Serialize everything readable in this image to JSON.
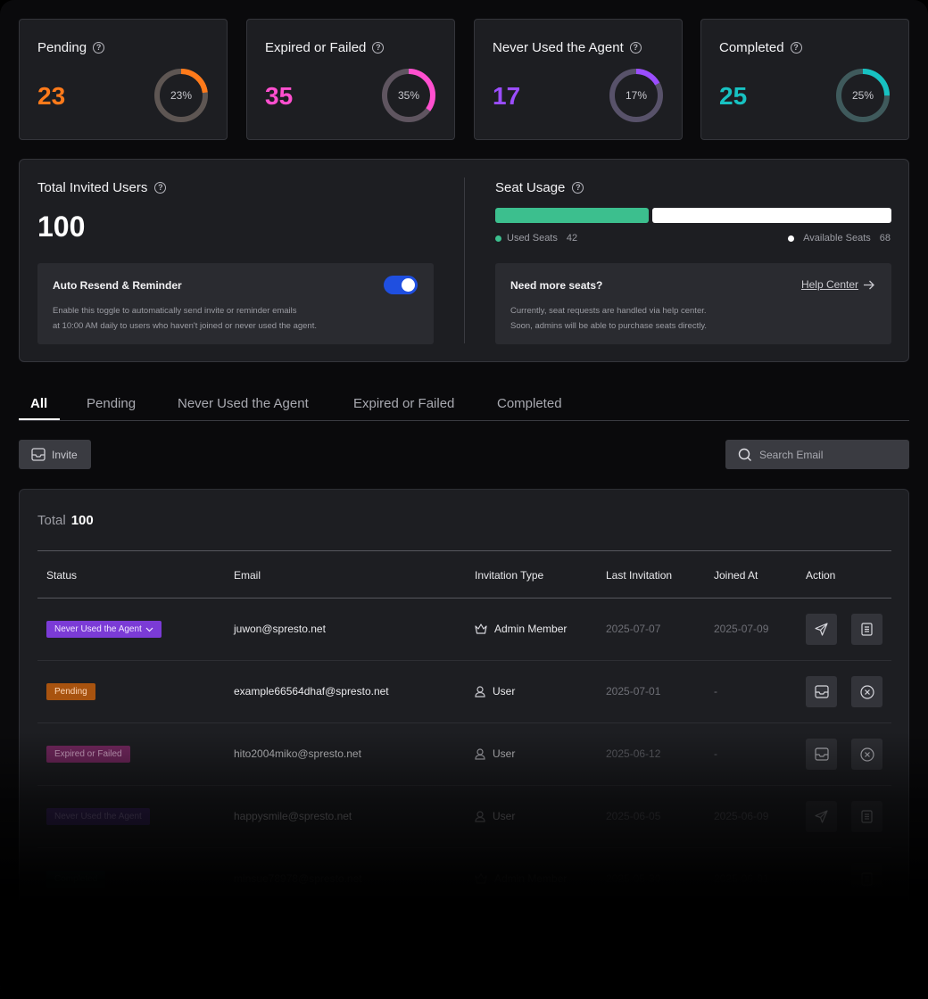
{
  "stats": [
    {
      "title": "Pending",
      "value": "23",
      "percent_label": "23%",
      "percent": 0.23,
      "color": "#ff7a1a",
      "track": "#5e5653"
    },
    {
      "title": "Expired or Failed",
      "value": "35",
      "percent_label": "35%",
      "percent": 0.35,
      "color": "#ff4fcf",
      "track": "#5f5560"
    },
    {
      "title": "Never Used the Agent",
      "value": "17",
      "percent_label": "17%",
      "percent": 0.17,
      "color": "#9b4dff",
      "track": "#58526a"
    },
    {
      "title": "Completed",
      "value": "25",
      "percent_label": "25%",
      "percent": 0.25,
      "color": "#17c2c2",
      "track": "#3f5a5c"
    }
  ],
  "summary": {
    "total_title": "Total Invited Users",
    "total_value": "100",
    "auto": {
      "title": "Auto Resend & Reminder",
      "line1": "Enable this toggle to automatically send invite or reminder emails",
      "line2": "at 10:00 AM daily to users who haven't joined or never used the agent."
    },
    "seat_title": "Seat Usage",
    "used_label": "Used Seats",
    "used_value": "42",
    "available_label": "Available Seats",
    "available_value": "68",
    "used_fraction": 0.42,
    "seats_box": {
      "title": "Need more seats?",
      "link": "Help Center",
      "line1": "Currently, seat requests are handled via help center.",
      "line2": "Soon, admins will be able to purchase seats directly."
    }
  },
  "tabs": [
    "All",
    "Pending",
    "Never Used the Agent",
    "Expired or Failed",
    "Completed"
  ],
  "invite_label": "Invite",
  "search_placeholder": "Search Email",
  "table": {
    "total_label": "Total",
    "total_value": "100",
    "headers": [
      "Status",
      "Email",
      "Invitation Type",
      "Last Invitation",
      "Joined At",
      "Action"
    ],
    "rows": [
      {
        "status": "Never Used the Agent",
        "email": "juwon@spresto.net",
        "type": "Admin Member",
        "last": "2025-07-07",
        "joined": "2025-07-09"
      },
      {
        "status": "Pending",
        "email": "example66564dhaf@spresto.net",
        "type": "User",
        "last": "2025-07-01",
        "joined": "-"
      },
      {
        "status": "Expired or Failed",
        "email": "hito2004miko@spresto.net",
        "type": "User",
        "last": "2025-06-12",
        "joined": "-"
      },
      {
        "status": "Never Used the Agent",
        "email": "happysmile@spresto.net",
        "type": "User",
        "last": "2025-06-05",
        "joined": "2025-06-09"
      },
      {
        "status": "Completed",
        "email": "minsue78978@spresto.net",
        "type": "Admin Member",
        "last": "2025-05-30",
        "joined": "2025-06-01"
      }
    ]
  }
}
